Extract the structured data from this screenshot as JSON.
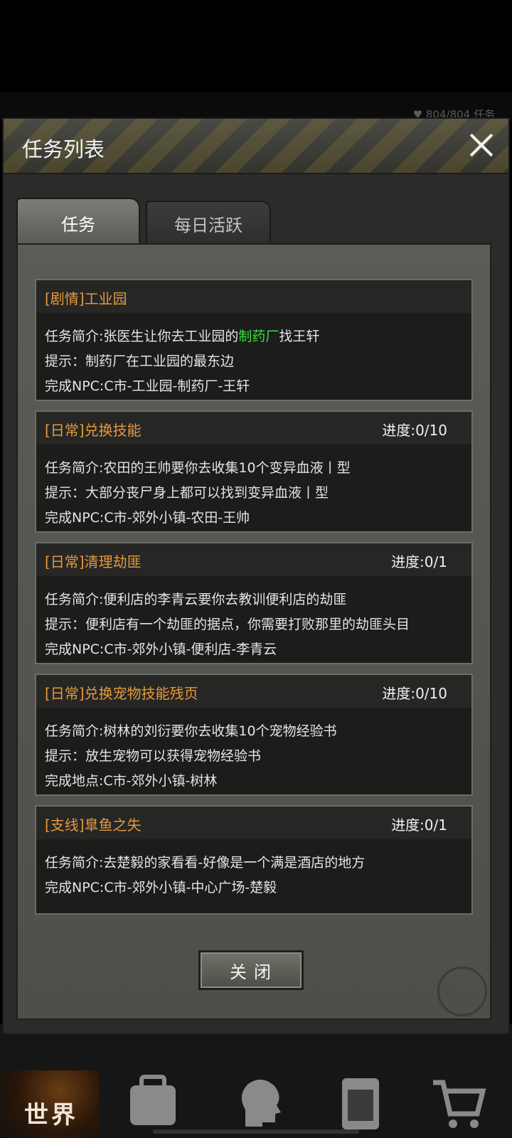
{
  "background": {
    "status_text": "♥ 804/804    任务"
  },
  "dialog": {
    "title": "任务列表",
    "tabs": [
      {
        "label": "任务",
        "active": true
      },
      {
        "label": "每日活跃",
        "active": false
      }
    ],
    "quests": [
      {
        "title": "[剧情]工业园",
        "progress": "",
        "desc_prefix": "任务简介:张医生让你去工业园的",
        "desc_highlight": "制药厂",
        "desc_suffix": "找王轩",
        "hint": "提示：制药厂在工业园的最东边",
        "target": "完成NPC:C市-工业园-制药厂-王轩"
      },
      {
        "title": "[日常]兑换技能",
        "progress": "进度:0/10",
        "desc": "任务简介:农田的王帅要你去收集10个变异血液丨型",
        "hint": "提示：大部分丧尸身上都可以找到变异血液丨型",
        "target": "完成NPC:C市-郊外小镇-农田-王帅"
      },
      {
        "title": "[日常]清理劫匪",
        "progress": "进度:0/1",
        "desc": "任务简介:便利店的李青云要你去教训便利店的劫匪",
        "hint": "提示：便利店有一个劫匪的据点，你需要打败那里的劫匪头目",
        "target": "完成NPC:C市-郊外小镇-便利店-李青云"
      },
      {
        "title": "[日常]兑换宠物技能残页",
        "progress": "进度:0/10",
        "desc": "任务简介:树林的刘衍要你去收集10个宠物经验书",
        "hint": "提示：放生宠物可以获得宠物经验书",
        "target": "完成地点:C市-郊外小镇-树林"
      },
      {
        "title": "[支线]臯鱼之失",
        "progress": "进度:0/1",
        "desc": "任务简介:去楚毅的家看看-好像是一个满是酒店的地方",
        "target": "完成NPC:C市-郊外小镇-中心广场-楚毅"
      }
    ],
    "close_button": "关闭"
  },
  "bottom_nav": {
    "world_label": "世界",
    "icons": [
      "backpack-icon",
      "head-icon",
      "phone-icon",
      "cart-icon"
    ]
  }
}
